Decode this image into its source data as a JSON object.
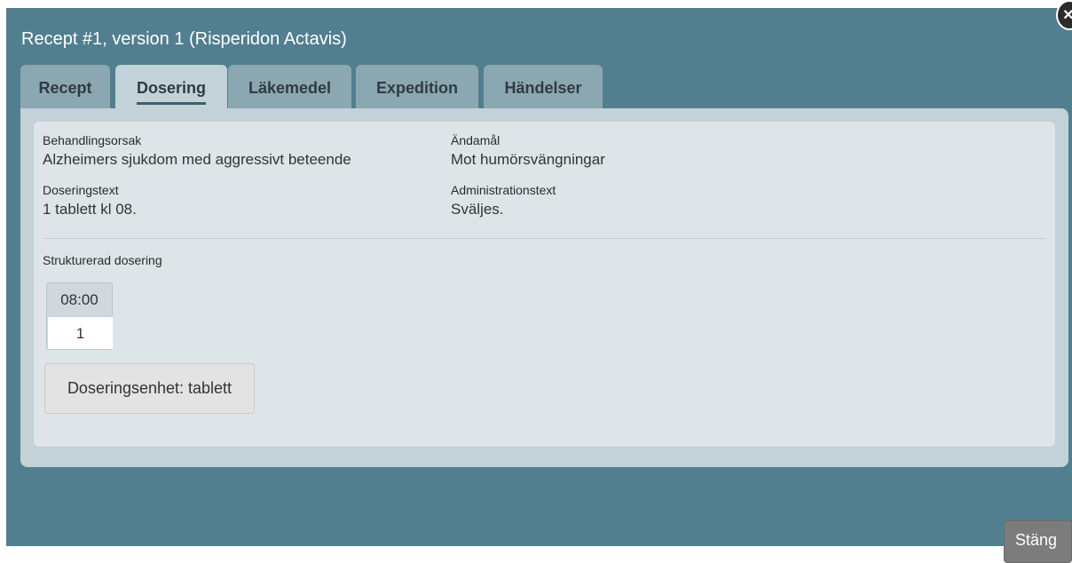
{
  "dialog": {
    "title": "Recept #1, version 1 (Risperidon Actavis)",
    "close_badge_label": "×"
  },
  "tabs": [
    {
      "label": "Recept",
      "active": false
    },
    {
      "label": "Dosering",
      "active": true
    },
    {
      "label": "Läkemedel",
      "active": false
    },
    {
      "label": "Expedition",
      "active": false
    },
    {
      "label": "Händelser",
      "active": false
    }
  ],
  "fields": {
    "behandlingsorsak": {
      "label": "Behandlingsorsak",
      "value": "Alzheimers sjukdom med aggressivt beteende"
    },
    "andamal": {
      "label": "Ändamål",
      "value": "Mot humörsvängningar"
    },
    "doseringstext": {
      "label": "Doseringstext",
      "value": "1 tablett kl 08."
    },
    "administrationstext": {
      "label": "Administrationstext",
      "value": "Sväljes."
    }
  },
  "structured_dosing": {
    "label": "Strukturerad dosering",
    "time": "08:00",
    "amount": "1"
  },
  "unit_button_label": "Doseringsenhet: tablett",
  "footer": {
    "close_label": "Stäng"
  },
  "colors": {
    "dialog_background": "#527f8f",
    "panel_background": "#c3d2d8",
    "inner_background": "#dde5e8",
    "inactive_tab": "#8ba7b2",
    "close_button": "#7c7c7c"
  }
}
